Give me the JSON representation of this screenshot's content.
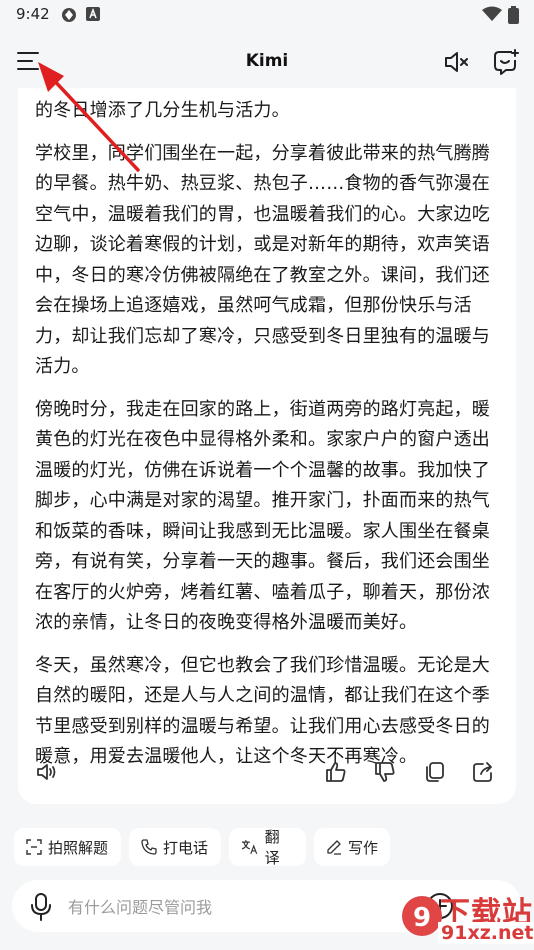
{
  "status_bar": {
    "time": "9:42"
  },
  "header": {
    "title": "Kimi"
  },
  "message": {
    "paragraphs": [
      "的冬日增添了几分生机与活力。",
      "学校里，同学们围坐在一起，分享着彼此带来的热气腾腾的早餐。热牛奶、热豆浆、热包子……食物的香气弥漫在空气中，温暖着我们的胃，也温暖着我们的心。大家边吃边聊，谈论着寒假的计划，或是对新年的期待，欢声笑语中，冬日的寒冷仿佛被隔绝在了教室之外。课间，我们还会在操场上追逐嬉戏，虽然呵气成霜，但那份快乐与活力，却让我们忘却了寒冷，只感受到冬日里独有的温暖与活力。",
      "傍晚时分，我走在回家的路上，街道两旁的路灯亮起，暖黄色的灯光在夜色中显得格外柔和。家家户户的窗户透出温暖的灯光，仿佛在诉说着一个个温馨的故事。我加快了脚步，心中满是对家的渴望。推开家门，扑面而来的热气和饭菜的香味，瞬间让我感到无比温暖。家人围坐在餐桌旁，有说有笑，分享着一天的趣事。餐后，我们还会围坐在客厅的火炉旁，烤着红薯、嗑着瓜子，聊着天，那份浓浓的亲情，让冬日的夜晚变得格外温暖而美好。",
      "冬天，虽然寒冷，但它也教会了我们珍惜温暖。无论是大自然的暖阳，还是人与人之间的温情，都让我们在这个季节里感受到别样的温暖与希望。让我们用心去感受冬日的暖意，用爱去温暖他人，让这个冬天不再寒冷。"
    ]
  },
  "quick_actions": [
    {
      "label": "拍照解题",
      "icon": "scan-icon"
    },
    {
      "label": "打电话",
      "icon": "phone-icon"
    },
    {
      "label": "翻译",
      "icon": "translate-icon"
    },
    {
      "label": "写作",
      "icon": "pen-icon"
    }
  ],
  "input": {
    "placeholder": "有什么问题尽管问我"
  },
  "watermark": {
    "big": "下载站",
    "small": "91xz.net"
  },
  "colors": {
    "background": "#f5f6f8",
    "card": "#ffffff",
    "arrow": "#e02020",
    "watermark": "#d93b3b"
  }
}
